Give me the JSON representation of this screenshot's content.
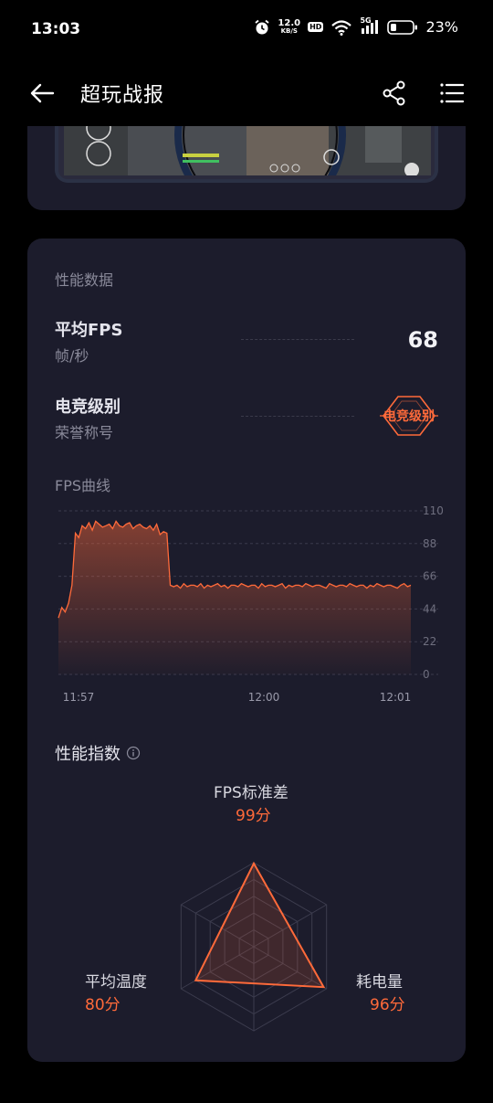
{
  "status": {
    "time": "13:03",
    "net_speed_value": "12.0",
    "net_speed_unit": "KB/S",
    "hd": "HD",
    "signal_label": "5G",
    "battery_pct": "23%"
  },
  "header": {
    "title": "超玩战报"
  },
  "performance": {
    "section_title": "性能数据",
    "avg_fps": {
      "name": "平均FPS",
      "unit": "帧/秒",
      "value": "68"
    },
    "esports_level": {
      "name": "电竞级别",
      "sub": "荣誉称号",
      "badge": "电竞级别"
    },
    "fps_curve_title": "FPS曲线",
    "index_title": "性能指数"
  },
  "chart_data": {
    "type": "area",
    "title": "FPS曲线",
    "y_ticks": [
      "110",
      "88",
      "66",
      "44",
      "22",
      "0"
    ],
    "ylim": [
      0,
      110
    ],
    "x_ticks": [
      "11:57",
      "12:00",
      "12:01"
    ],
    "series": [
      {
        "values": [
          38,
          45,
          42,
          48,
          60,
          95,
          92,
          100,
          98,
          102,
          97,
          103,
          101,
          99,
          100,
          101,
          98,
          103,
          100,
          99,
          101,
          102,
          98,
          100,
          101,
          99,
          98,
          100,
          97,
          101,
          94,
          96,
          95,
          60,
          59,
          60,
          58,
          61,
          59,
          60,
          60,
          59,
          61,
          58,
          60,
          59,
          60,
          61,
          59,
          60,
          58,
          60,
          60,
          59,
          61,
          60,
          59,
          60,
          60,
          58,
          61,
          59,
          60,
          60,
          59,
          60,
          61,
          58,
          60,
          59,
          60,
          60,
          59,
          61,
          60,
          59,
          60,
          60,
          59,
          58,
          61,
          60,
          59,
          60,
          60,
          59,
          61,
          60,
          59,
          60,
          60,
          58,
          60,
          59,
          61,
          60,
          59,
          60,
          60,
          59,
          58,
          60,
          61,
          59,
          60
        ]
      }
    ],
    "grid": true
  },
  "radar": {
    "axes": [
      {
        "label": "FPS标准差",
        "score": "99分"
      },
      {
        "label": "耗电量",
        "score": "96分"
      },
      {
        "label": "平均温度",
        "score": "80分"
      }
    ],
    "values": [
      99,
      96,
      80
    ],
    "accent": "#ff6a3a"
  }
}
